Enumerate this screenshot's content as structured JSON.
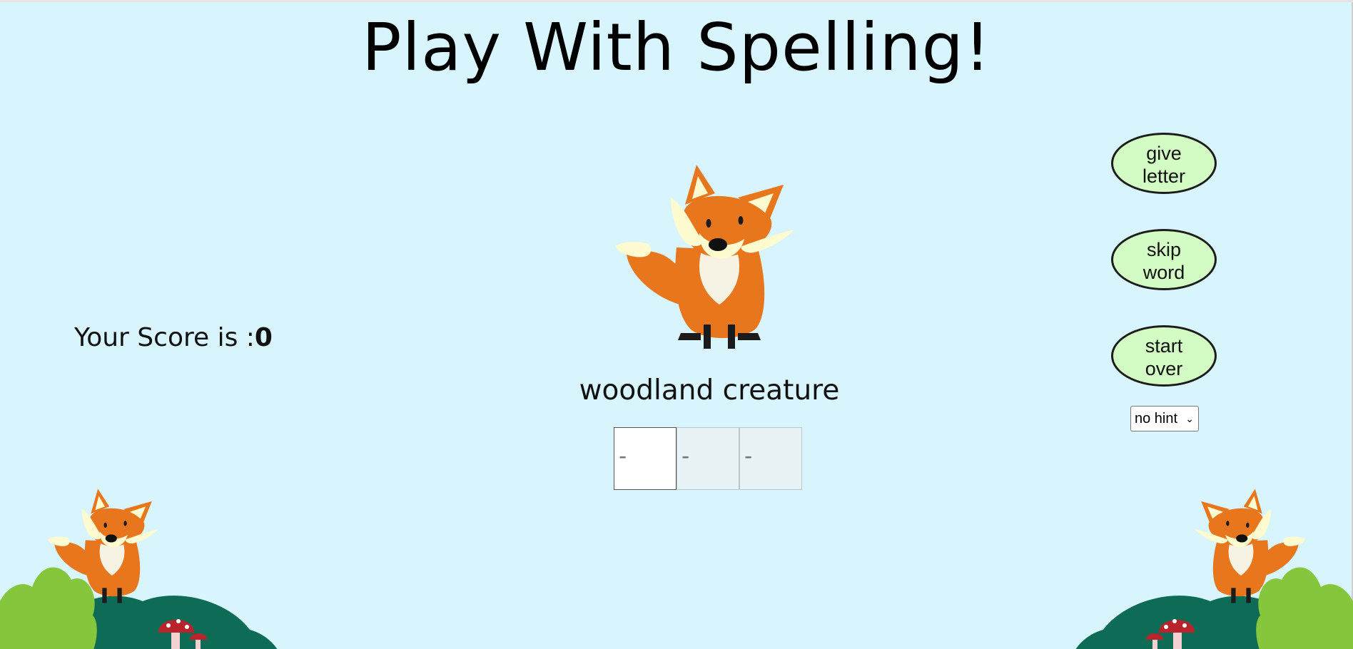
{
  "title": "Play With Spelling!",
  "score": {
    "label": "Your Score is :",
    "value": "0"
  },
  "clue": "woodland creature",
  "word_boxes": [
    "-",
    "-",
    "-"
  ],
  "buttons": {
    "give_letter_line1": "give",
    "give_letter_line2": "letter",
    "skip_word_line1": "skip",
    "skip_word_line2": "word",
    "start_over_line1": "start",
    "start_over_line2": "over"
  },
  "hint_select": {
    "selected": "no hint"
  },
  "icons": {
    "main_image": "fox-icon",
    "decoration_left": "fox-bush-mushroom-scene",
    "decoration_right": "fox-bush-mushroom-scene"
  },
  "colors": {
    "background": "#d8f4fd",
    "button_fill": "#d3fcc5",
    "fox_orange": "#e8761c"
  }
}
